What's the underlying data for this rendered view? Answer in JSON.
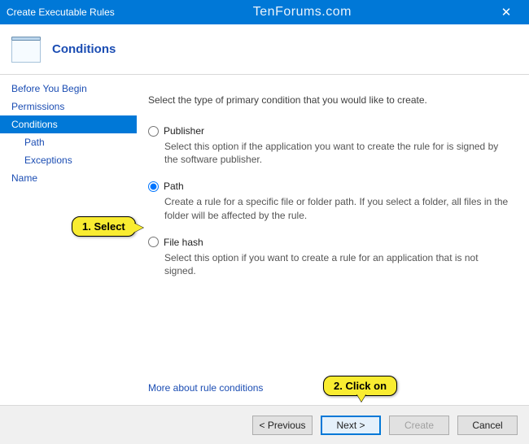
{
  "titlebar": {
    "title": "Create Executable Rules",
    "watermark": "TenForums.com",
    "close": "✕"
  },
  "header": {
    "heading": "Conditions"
  },
  "sidebar": {
    "items": [
      {
        "label": "Before You Begin"
      },
      {
        "label": "Permissions"
      },
      {
        "label": "Conditions"
      },
      {
        "label": "Path"
      },
      {
        "label": "Exceptions"
      },
      {
        "label": "Name"
      }
    ]
  },
  "main": {
    "intro": "Select the type of primary condition that you would like to create.",
    "options": {
      "publisher": {
        "label": "Publisher",
        "desc": "Select this option if the application you want to create the rule for is signed by the software publisher."
      },
      "path": {
        "label": "Path",
        "desc": "Create a rule for a specific file or folder path. If you select a folder, all files in the folder will be affected by the rule."
      },
      "filehash": {
        "label": "File hash",
        "desc": "Select this option if you want to create a rule for an application that is not signed."
      }
    },
    "morelink": "More about rule conditions"
  },
  "buttons": {
    "previous": "< Previous",
    "next": "Next >",
    "create": "Create",
    "cancel": "Cancel"
  },
  "callouts": {
    "select": "1. Select",
    "clickon": "2. Click on"
  }
}
